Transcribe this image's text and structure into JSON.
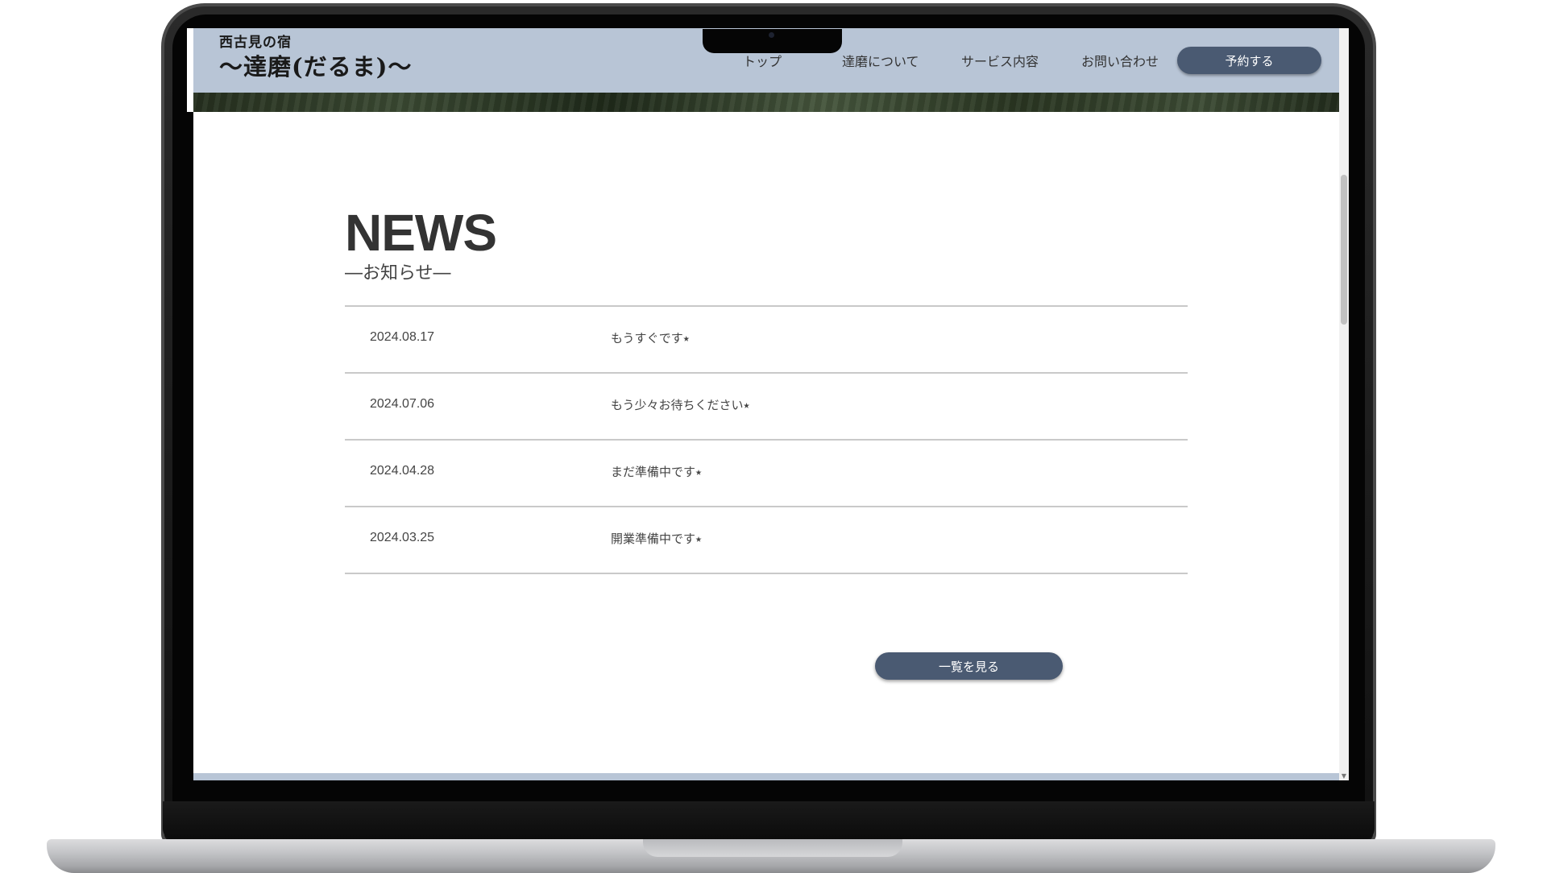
{
  "header": {
    "brand_sub": "西古見の宿",
    "brand_main": "〜達磨(だるま)〜",
    "nav": {
      "top": "トップ",
      "about": "達磨について",
      "services": "サービス内容",
      "contact": "お問い合わせ"
    },
    "reserve_label": "予約する",
    "bg_color": "#b8c5d6",
    "button_color": "#4a5a72"
  },
  "news": {
    "heading": "NEWS",
    "subheading": "―お知らせ―",
    "items": [
      {
        "date": "2024.08.17",
        "title": "もうすぐです⭑"
      },
      {
        "date": "2024.07.06",
        "title": "もう少々お待ちください⭑"
      },
      {
        "date": "2024.04.28",
        "title": "まだ準備中です⭑"
      },
      {
        "date": "2024.03.25",
        "title": "開業準備中です⭑"
      }
    ],
    "view_all_label": "一覧を見る"
  }
}
